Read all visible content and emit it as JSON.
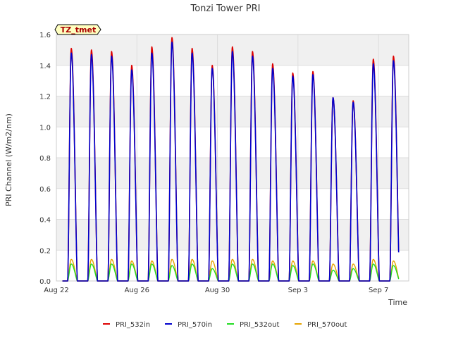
{
  "chart_data": {
    "type": "line",
    "title": "Tonzi Tower PRI",
    "xlabel": "Time",
    "ylabel": "PRI Channel (W/m2/nm)",
    "site_label": "TZ_tmet",
    "xlim": [
      0,
      17.5
    ],
    "ylim": [
      0,
      1.6
    ],
    "x_unit": "days since Aug 22",
    "x_ticks": [
      {
        "value": 0,
        "label": "Aug 22"
      },
      {
        "value": 4,
        "label": "Aug 26"
      },
      {
        "value": 8,
        "label": "Aug 30"
      },
      {
        "value": 12,
        "label": "Sep 3"
      },
      {
        "value": 16,
        "label": "Sep 7"
      }
    ],
    "y_ticks": [
      {
        "value": 0.0,
        "label": "0.0"
      },
      {
        "value": 0.2,
        "label": "0.2"
      },
      {
        "value": 0.4,
        "label": "0.4"
      },
      {
        "value": 0.6,
        "label": "0.6"
      },
      {
        "value": 0.8,
        "label": "0.8"
      },
      {
        "value": 1.0,
        "label": "1.0"
      },
      {
        "value": 1.2,
        "label": "1.2"
      },
      {
        "value": 1.4,
        "label": "1.4"
      },
      {
        "value": 1.6,
        "label": "1.6"
      }
    ],
    "grid": true,
    "legend_position": "bottom",
    "series": [
      {
        "name": "PRI_532in",
        "color": "#dd0000"
      },
      {
        "name": "PRI_570in",
        "color": "#0000cc"
      },
      {
        "name": "PRI_532out",
        "color": "#22dd22"
      },
      {
        "name": "PRI_570out",
        "color": "#e6a400"
      }
    ],
    "daily_peaks": {
      "days": [
        "Aug 22",
        "Aug 23",
        "Aug 24",
        "Aug 25",
        "Aug 26",
        "Aug 27",
        "Aug 28",
        "Aug 29",
        "Aug 30",
        "Aug 31",
        "Sep 1",
        "Sep 2",
        "Sep 3",
        "Sep 4",
        "Sep 5",
        "Sep 6",
        "Sep 7"
      ],
      "PRI_532in": [
        1.51,
        1.5,
        1.49,
        1.4,
        1.52,
        1.58,
        1.51,
        1.4,
        1.52,
        1.49,
        1.41,
        1.35,
        1.36,
        1.19,
        1.17,
        1.44,
        1.46
      ],
      "PRI_570in": [
        1.48,
        1.47,
        1.46,
        1.37,
        1.48,
        1.55,
        1.48,
        1.38,
        1.49,
        1.46,
        1.38,
        1.33,
        1.34,
        1.19,
        1.16,
        1.41,
        1.43
      ],
      "PRI_532out": [
        0.11,
        0.11,
        0.11,
        0.11,
        0.11,
        0.1,
        0.11,
        0.08,
        0.11,
        0.11,
        0.11,
        0.1,
        0.11,
        0.07,
        0.08,
        0.11,
        0.1
      ],
      "PRI_570out": [
        0.14,
        0.14,
        0.14,
        0.13,
        0.13,
        0.14,
        0.14,
        0.13,
        0.14,
        0.14,
        0.13,
        0.13,
        0.13,
        0.11,
        0.11,
        0.14,
        0.13
      ]
    }
  }
}
